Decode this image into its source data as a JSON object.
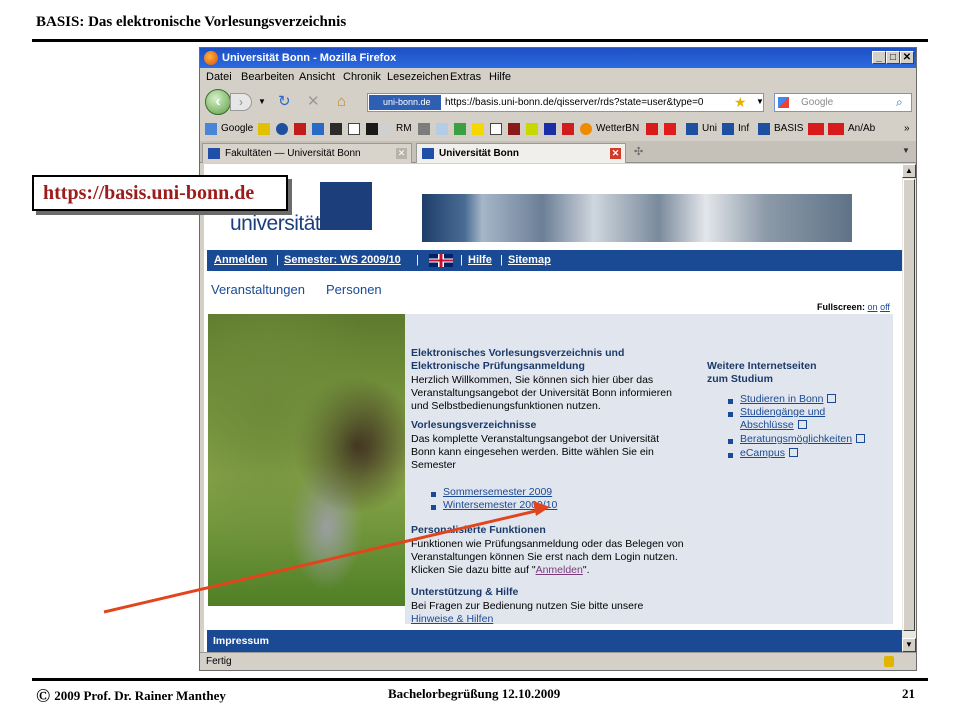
{
  "slide": {
    "title": "BASIS: Das elektronische Vorlesungsverzeichnis",
    "url_label": "https://basis.uni-bonn.de",
    "footer_left": "2009  Prof. Dr. Rainer Manthey",
    "footer_center": "Bachelorbegrüßung 12.10.2009",
    "footer_page": "21",
    "copyright_symbol": "©"
  },
  "browser": {
    "window_title": "Universität Bonn - Mozilla Firefox",
    "menu": [
      "Datei",
      "Bearbeiten",
      "Ansicht",
      "Chronik",
      "Lesezeichen",
      "Extras",
      "Hilfe"
    ],
    "url_site_badge": "uni-bonn.de",
    "url": "https://basis.uni-bonn.de/qisserver/rds?state=user&type=0",
    "search_placeholder": "Google",
    "bookmarks": [
      "Google",
      "RM",
      "WetterBN",
      "Uni",
      "Inf",
      "BASIS",
      "An/Ab"
    ],
    "tabs": [
      {
        "label": "Fakultäten — Universität Bonn"
      },
      {
        "label": "Universität Bonn"
      }
    ],
    "status": "Fertig"
  },
  "page": {
    "logo_text_prefix": "universität",
    "logo_text_bold": "bonn",
    "nav": {
      "login": "Anmelden",
      "semester": "Semester: WS 2009/10",
      "help": "Hilfe",
      "sitemap": "Sitemap",
      "sep": "|"
    },
    "subtabs": [
      "Veranstaltungen",
      "Personen"
    ],
    "fullscreen_label": "Fullscreen:",
    "fullscreen_on": "on",
    "fullscreen_off": "off",
    "intro_heading_1": "Elektronisches Vorlesungsverzeichnis und",
    "intro_heading_2": "Elektronische Prüfungsanmeldung",
    "intro_text_1": "Herzlich Willkommen, Sie können sich hier über das",
    "intro_text_2": "Veranstaltungsangebot der Universität Bonn informieren",
    "intro_text_3": "und Selbstbedienungsfunktionen nutzen.",
    "vv_heading": "Vorlesungsverzeichnisse",
    "vv_text_1": "Das komplette Veranstaltungsangebot der Universität",
    "vv_text_2": "Bonn kann eingesehen werden. Bitte wählen Sie ein",
    "vv_text_3": "Semester",
    "semesters": [
      "Sommersemester 2009",
      "Wintersemester 2009/10"
    ],
    "pf_heading": "Personalisierte Funktionen",
    "pf_text_1": "Funktionen wie Prüfungsanmeldung oder das Belegen von",
    "pf_text_2": "Veranstaltungen können Sie erst nach dem Login nutzen.",
    "pf_text_3_pre": "Klicken Sie dazu bitte auf \"",
    "pf_text_3_link": "Anmelden",
    "pf_text_3_post": "\".",
    "help_heading": "Unterstützung & Hilfe",
    "help_text": "Bei Fragen zur Bedienung nutzen Sie bitte unsere",
    "help_link": "Hinweise & Hilfen",
    "side_heading_1": "Weitere Internetseiten",
    "side_heading_2": "zum Studium",
    "side_links": [
      "Studieren in Bonn",
      "Studiengänge und",
      "Abschlüsse",
      "Beratungsmöglichkeiten",
      "eCampus"
    ],
    "footer_bar": "Impressum"
  }
}
